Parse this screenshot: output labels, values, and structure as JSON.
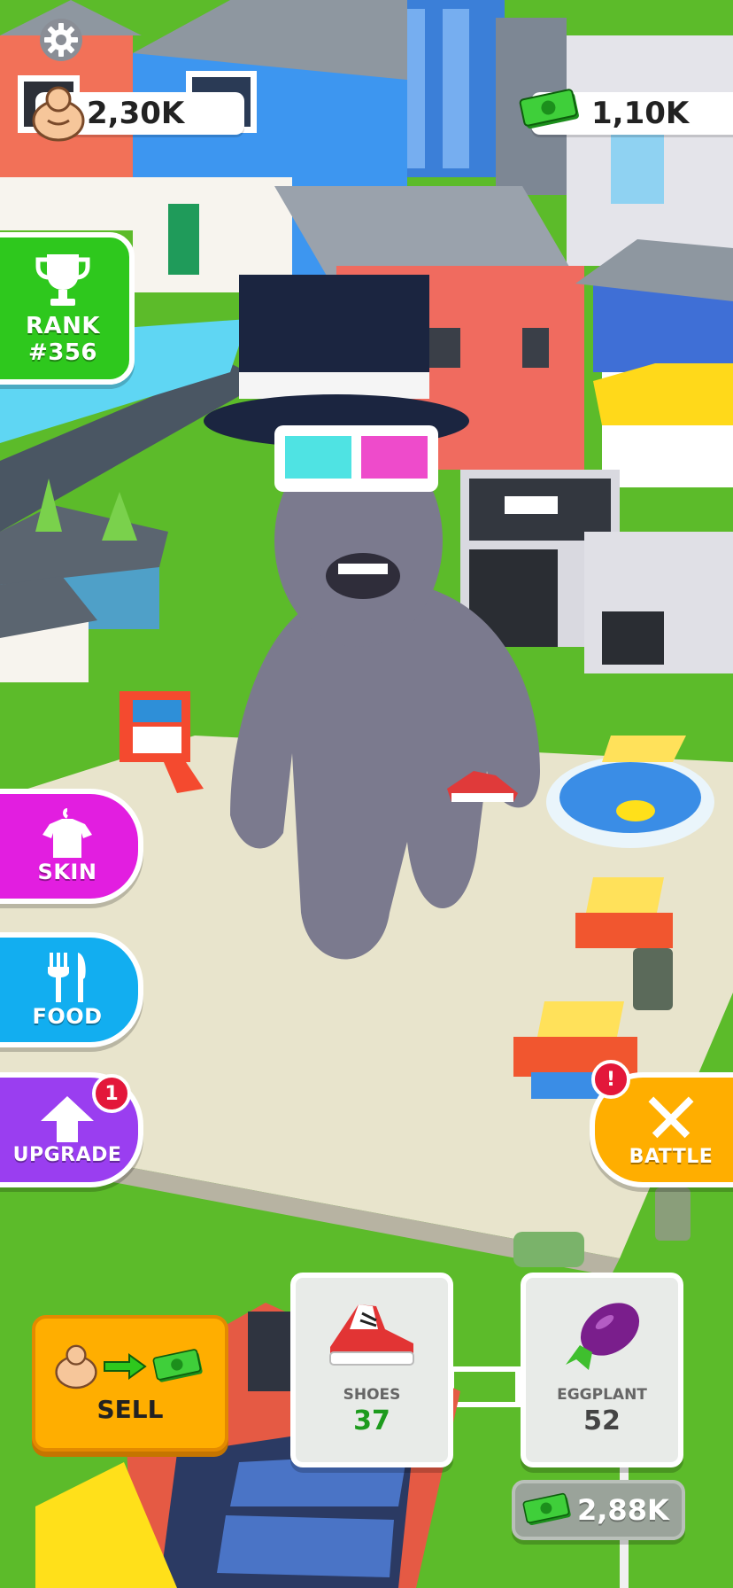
{
  "hud": {
    "strength": "2,30K",
    "money": "1,10K",
    "settings_icon": "gear-icon"
  },
  "rank": {
    "label": "RANK",
    "value": "#356"
  },
  "side_buttons": {
    "skin": "SKIN",
    "food": "FOOD",
    "upgrade": "UPGRADE",
    "upgrade_badge": "1",
    "battle": "BATTLE",
    "battle_badge": "!"
  },
  "sell": {
    "label": "SELL"
  },
  "items": [
    {
      "name": "SHOES",
      "count": "37",
      "count_color": "#1d9b1d"
    },
    {
      "name": "EGGPLANT",
      "count": "52",
      "count_color": "#444444"
    }
  ],
  "bottom_money": "2,88K",
  "colors": {
    "rank_green": "#2ec81d",
    "skin_magenta": "#e21ee0",
    "food_blue": "#12aef0",
    "upgrade_purple": "#9a3ef0",
    "battle_orange": "#ffae00",
    "sell_orange": "#ffae00"
  }
}
